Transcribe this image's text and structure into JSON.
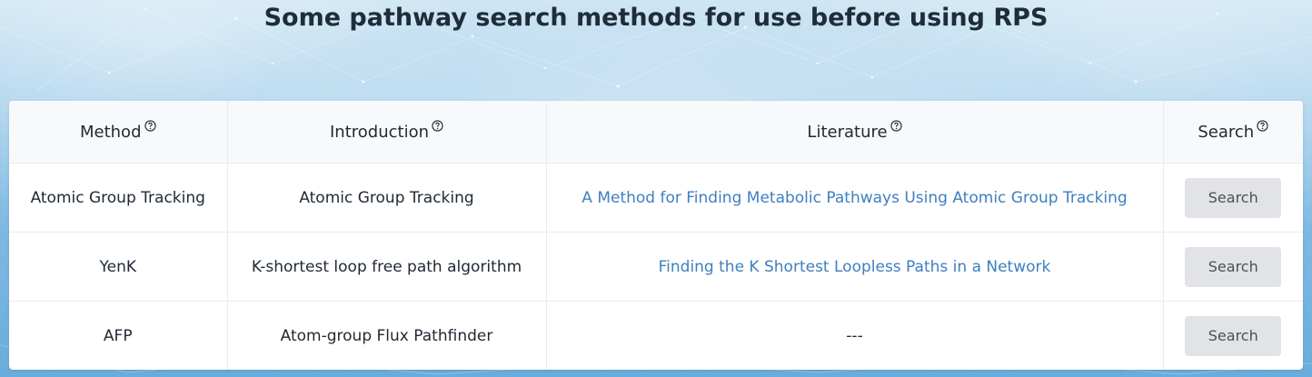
{
  "page": {
    "title": "Some pathway search methods for use before using RPS"
  },
  "table": {
    "headers": {
      "method": "Method",
      "introduction": "Introduction",
      "literature": "Literature",
      "search": "Search"
    },
    "rows": [
      {
        "method": "Atomic Group Tracking",
        "introduction": "Atomic Group Tracking",
        "literature": "A Method for Finding Metabolic Pathways Using Atomic Group Tracking",
        "literature_is_link": true,
        "search_label": "Search"
      },
      {
        "method": "YenK",
        "introduction": "K-shortest loop free path algorithm",
        "literature": "Finding the K Shortest Loopless Paths in a Network",
        "literature_is_link": true,
        "search_label": "Search"
      },
      {
        "method": "AFP",
        "introduction": "Atom-group Flux Pathfinder",
        "literature": "---",
        "literature_is_link": false,
        "search_label": "Search"
      }
    ]
  },
  "colors": {
    "link": "#3f7fbf",
    "button_bg": "#e1e3e6",
    "header_bg": "#f8f9fb",
    "title_text": "#1f2d3a"
  },
  "icons": {
    "help": "question-circle-icon"
  }
}
